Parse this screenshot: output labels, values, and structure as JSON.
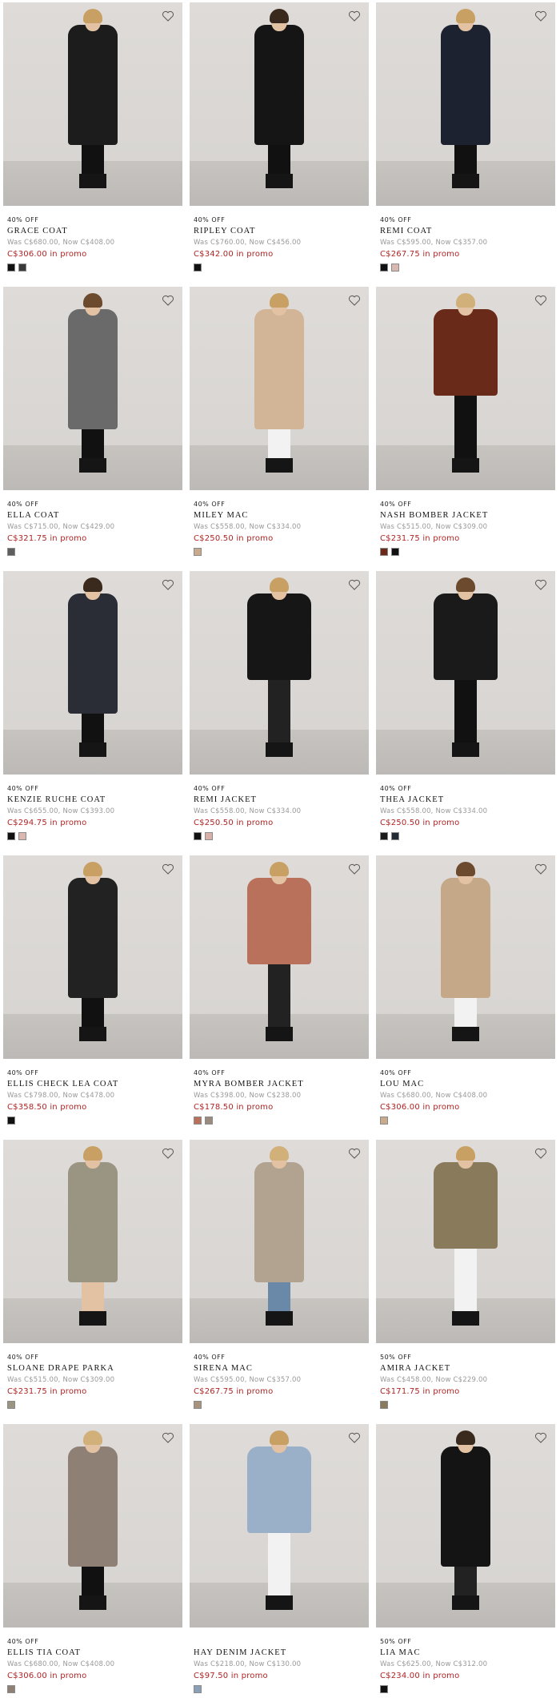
{
  "products": [
    {
      "promo": "40% OFF",
      "name": "GRACE COAT",
      "was_now": "Was C$680.00, Now C$408.00",
      "price": "C$306.00 in promo",
      "coat_color": "#1c1c1c",
      "swatches": [
        "#111111",
        "#3a3a3a"
      ],
      "heart": "heart-icon"
    },
    {
      "promo": "40% OFF",
      "name": "RIPLEY COAT",
      "was_now": "Was C$760.00, Now C$456.00",
      "price": "C$342.00 in promo",
      "coat_color": "#151515",
      "swatches": [
        "#111111"
      ],
      "heart": "heart-icon"
    },
    {
      "promo": "40% OFF",
      "name": "REMI COAT",
      "was_now": "Was C$595.00, Now C$357.00",
      "price": "C$267.75 in promo",
      "coat_color": "#1d2230",
      "swatches": [
        "#111111",
        "#d8b8b0"
      ],
      "heart": "heart-icon"
    },
    {
      "promo": "40% OFF",
      "name": "ELLA COAT",
      "was_now": "Was C$715.00, Now C$429.00",
      "price": "C$321.75 in promo",
      "coat_color": "#6a6a6a",
      "swatches": [
        "#5e5e5e"
      ],
      "heart": "heart-icon"
    },
    {
      "promo": "40% OFF",
      "name": "MILEY MAC",
      "was_now": "Was C$558.00, Now C$334.00",
      "price": "C$250.50 in promo",
      "coat_color": "#d2b496",
      "swatches": [
        "#c8aa8c"
      ],
      "heart": "heart-icon"
    },
    {
      "promo": "40% OFF",
      "name": "NASH BOMBER JACKET",
      "was_now": "Was C$515.00, Now C$309.00",
      "price": "C$231.75 in promo",
      "coat_color": "#6a2a1a",
      "swatches": [
        "#6a2a1a",
        "#111111"
      ],
      "heart": "heart-icon"
    },
    {
      "promo": "40% OFF",
      "name": "KENZIE RUCHE COAT",
      "was_now": "Was C$655.00, Now C$393.00",
      "price": "C$294.75 in promo",
      "coat_color": "#2a2d35",
      "swatches": [
        "#111111",
        "#d8b8b0"
      ],
      "heart": "heart-icon"
    },
    {
      "promo": "40% OFF",
      "name": "REMI JACKET",
      "was_now": "Was C$558.00, Now C$334.00",
      "price": "C$250.50 in promo",
      "coat_color": "#161616",
      "swatches": [
        "#111111",
        "#d8b0a8"
      ],
      "heart": "heart-icon"
    },
    {
      "promo": "40% OFF",
      "name": "THEA JACKET",
      "was_now": "Was C$558.00, Now C$334.00",
      "price": "C$250.50 in promo",
      "coat_color": "#1a1a1a",
      "swatches": [
        "#1a1a1a",
        "#222a33"
      ],
      "heart": "heart-icon"
    },
    {
      "promo": "40% OFF",
      "name": "ELLIS CHECK LEA COAT",
      "was_now": "Was C$798.00, Now C$478.00",
      "price": "C$358.50 in promo",
      "coat_color": "#222222",
      "swatches": [
        "#111111"
      ],
      "heart": "heart-icon"
    },
    {
      "promo": "40% OFF",
      "name": "MYRA BOMBER JACKET",
      "was_now": "Was C$398.00, Now C$238.00",
      "price": "C$178.50 in promo",
      "coat_color": "#b9715c",
      "swatches": [
        "#b9715c",
        "#9a8a80"
      ],
      "heart": "heart-icon"
    },
    {
      "promo": "40% OFF",
      "name": "LOU MAC",
      "was_now": "Was C$680.00, Now C$408.00",
      "price": "C$306.00 in promo",
      "coat_color": "#c4a888",
      "swatches": [
        "#c8aa8c"
      ],
      "heart": "heart-icon"
    },
    {
      "promo": "40% OFF",
      "name": "SLOANE DRAPE PARKA",
      "was_now": "Was C$515.00, Now C$309.00",
      "price": "C$231.75 in promo",
      "coat_color": "#9a9482",
      "swatches": [
        "#9a9482"
      ],
      "heart": "heart-icon"
    },
    {
      "promo": "40% OFF",
      "name": "SIRENA MAC",
      "was_now": "Was C$595.00, Now C$357.00",
      "price": "C$267.75 in promo",
      "coat_color": "#b2a290",
      "swatches": [
        "#a8947e"
      ],
      "heart": "heart-icon"
    },
    {
      "promo": "50% OFF",
      "name": "AMIRA JACKET",
      "was_now": "Was C$458.00, Now C$229.00",
      "price": "C$171.75 in promo",
      "coat_color": "#8a7a5c",
      "swatches": [
        "#8a7a5c"
      ],
      "heart": "heart-icon"
    },
    {
      "promo": "40% OFF",
      "name": "ELLIS TIA COAT",
      "was_now": "Was C$680.00, Now C$408.00",
      "price": "C$306.00 in promo",
      "coat_color": "#8e8074",
      "swatches": [
        "#8e8074"
      ],
      "heart": "heart-icon"
    },
    {
      "promo": "",
      "name": "HAY DENIM JACKET",
      "was_now": "Was C$218.00, Now C$130.00",
      "price": "C$97.50 in promo",
      "coat_color": "#9ab0c8",
      "swatches": [
        "#8aa0b8"
      ],
      "heart": "heart-icon"
    },
    {
      "promo": "50% OFF",
      "name": "LIA MAC",
      "was_now": "Was C$625.00, Now C$312.00",
      "price": "C$234.00 in promo",
      "coat_color": "#141414",
      "swatches": [
        "#111111"
      ],
      "heart": "heart-icon"
    }
  ]
}
